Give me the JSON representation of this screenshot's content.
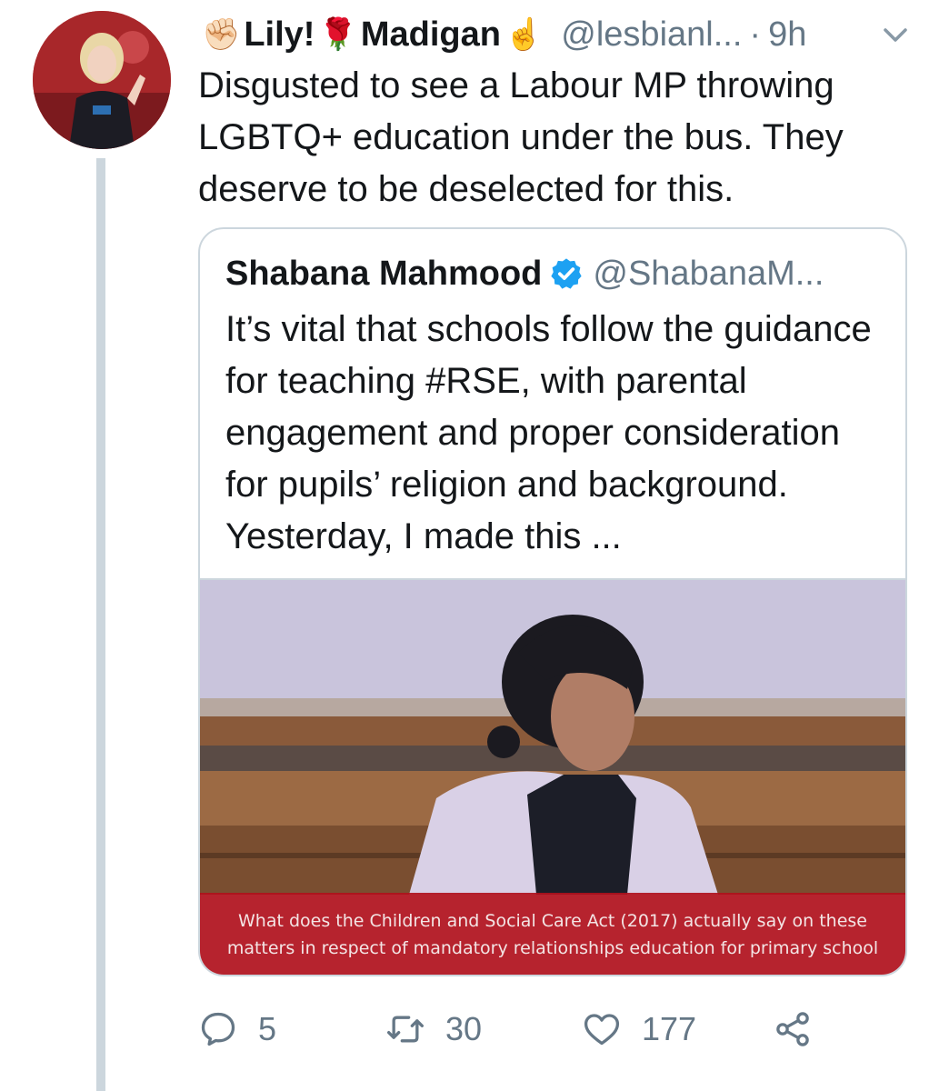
{
  "tweet": {
    "author": {
      "name_part1": "Lily!",
      "name_part2": "Madigan",
      "emoji_fist": "✊🏻",
      "emoji_rose": "🌹",
      "emoji_point": "☝️",
      "handle": "@lesbianl...",
      "separator": "·",
      "time": "9h"
    },
    "text": "Disgusted to see a Labour MP throwing LGBTQ+ education under the bus. They deserve to be deselected for this.",
    "quoted": {
      "name": "Shabana Mahmood",
      "handle": "@ShabanaM...",
      "text": "It’s vital that schools follow the guidance for teaching #RSE, with parental engagement and proper consideration for pupils’ religion and background. Yesterday, I made this ...",
      "video_caption_line1": "What does the Children and Social Care Act (2017) actually say on these",
      "video_caption_line2": "matters in respect of mandatory relationships education for primary school"
    },
    "actions": {
      "replies": "5",
      "retweets": "30",
      "likes": "177"
    }
  },
  "colors": {
    "text_primary": "#14171a",
    "text_secondary": "#657786",
    "border": "#ccd6dd",
    "verified_blue": "#1da1f2",
    "caption_red": "#b0101c"
  },
  "icons": [
    "caret-down-icon",
    "verified-badge-icon",
    "reply-icon",
    "retweet-icon",
    "like-icon",
    "share-icon"
  ]
}
